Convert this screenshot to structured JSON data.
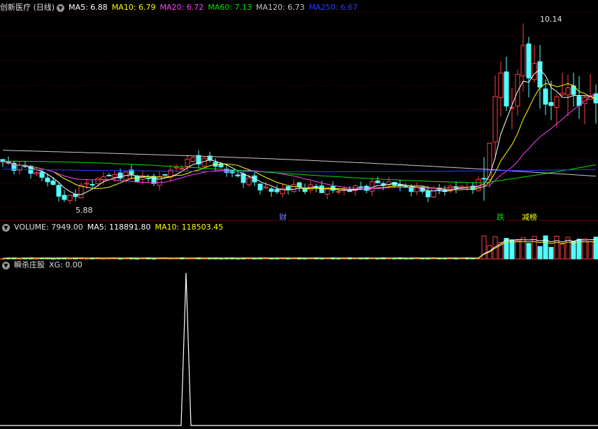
{
  "main_header": {
    "title": "创新医疗 (日线)",
    "ma5": "MA5: 6.88",
    "ma10": "MA10: 6.79",
    "ma20": "MA20: 6.72",
    "ma60": "MA60: 7.13",
    "ma120": "MA120: 6.73",
    "ma250": "MA250: 6.67"
  },
  "volume_header": {
    "volume": "VOLUME: 7949.00",
    "ma5": "MA5: 118891.80",
    "ma10": "MA10: 118503.45"
  },
  "indicator_header": {
    "name": "瞬杀庄股",
    "xg": "XG: 0.00"
  },
  "colors": {
    "up": "#ff4040",
    "down": "#54ffff",
    "ma5": "#ffffff",
    "ma10": "#ffff00",
    "ma20": "#ff40ff",
    "ma60": "#00e000",
    "ma120": "#c8c8c8",
    "ma250": "#2840ff",
    "grid": "#800000"
  },
  "chart_data": {
    "type": "candlestick",
    "price_labels": {
      "high": "10.14",
      "low": "5.88"
    },
    "markers": [
      "财",
      "跌",
      "减榜"
    ],
    "xg_spike": {
      "value": 1
    }
  }
}
